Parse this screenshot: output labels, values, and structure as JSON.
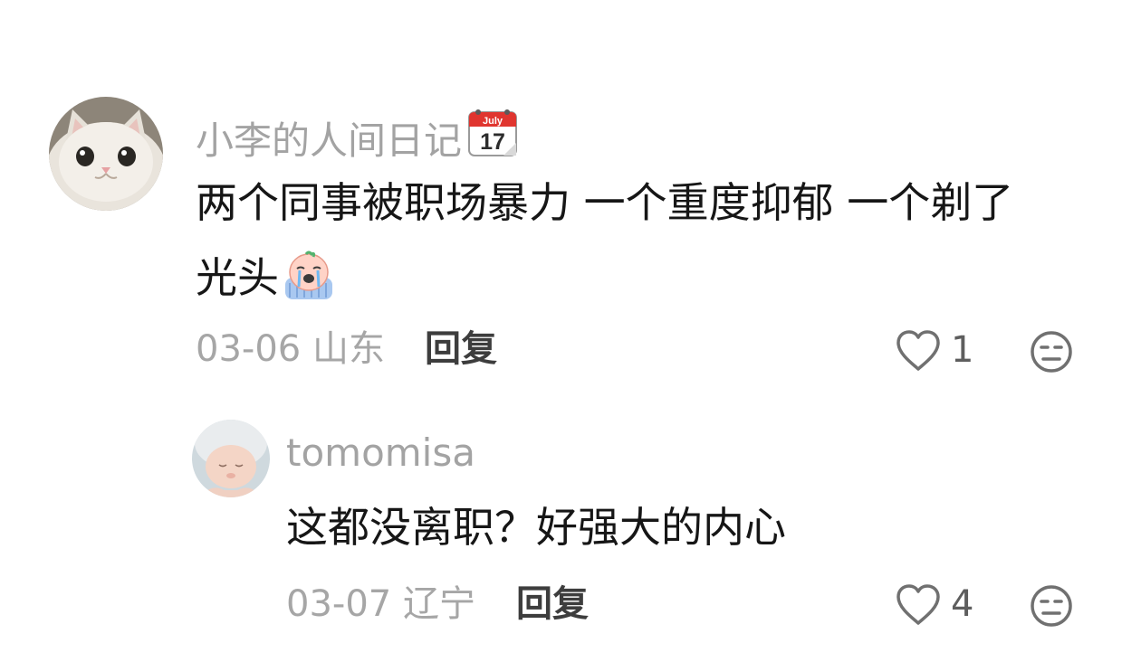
{
  "comments": [
    {
      "username": "小李的人间日记",
      "username_emoji": "calendar-july-17",
      "calendar_month": "July",
      "calendar_day": "17",
      "text_line1": "两个同事被职场暴力 一个重度抑郁 一个剃了",
      "text_line2": "光头",
      "text_emoji": "crying-face-emoji",
      "date": "03-06",
      "location": "山东",
      "reply_label": "回复",
      "like_count": "1",
      "avatar": "white-cat-avatar"
    },
    {
      "username": "tomomisa",
      "text_line1": "这都没离职？好强大的内心",
      "date": "03-07",
      "location": "辽宁",
      "reply_label": "回复",
      "like_count": "4",
      "avatar": "sleeping-baby-avatar"
    }
  ],
  "colors": {
    "username": "#a3a3a3",
    "text": "#161616",
    "meta": "#a6a6a6",
    "reply": "#3d3d3d",
    "icon": "#707070"
  }
}
